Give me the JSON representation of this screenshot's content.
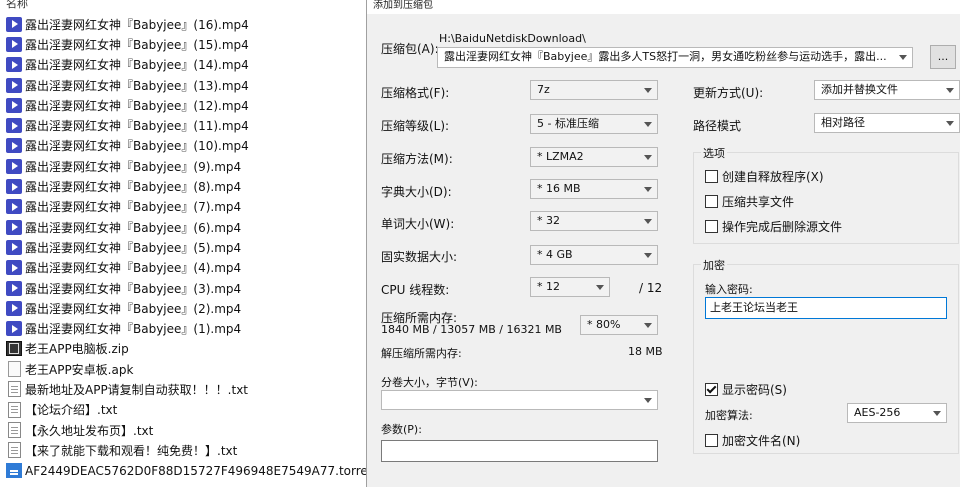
{
  "file_list": {
    "column_name": "名称",
    "files": [
      {
        "name": "露出淫妻网红女神『Babyjee』(16).mp4",
        "type": "video"
      },
      {
        "name": "露出淫妻网红女神『Babyjee』(15).mp4",
        "type": "video"
      },
      {
        "name": "露出淫妻网红女神『Babyjee』(14).mp4",
        "type": "video"
      },
      {
        "name": "露出淫妻网红女神『Babyjee』(13).mp4",
        "type": "video"
      },
      {
        "name": "露出淫妻网红女神『Babyjee』(12).mp4",
        "type": "video"
      },
      {
        "name": "露出淫妻网红女神『Babyjee』(11).mp4",
        "type": "video"
      },
      {
        "name": "露出淫妻网红女神『Babyjee』(10).mp4",
        "type": "video"
      },
      {
        "name": "露出淫妻网红女神『Babyjee』(9).mp4",
        "type": "video"
      },
      {
        "name": "露出淫妻网红女神『Babyjee』(8).mp4",
        "type": "video"
      },
      {
        "name": "露出淫妻网红女神『Babyjee』(7).mp4",
        "type": "video"
      },
      {
        "name": "露出淫妻网红女神『Babyjee』(6).mp4",
        "type": "video"
      },
      {
        "name": "露出淫妻网红女神『Babyjee』(5).mp4",
        "type": "video"
      },
      {
        "name": "露出淫妻网红女神『Babyjee』(4).mp4",
        "type": "video"
      },
      {
        "name": "露出淫妻网红女神『Babyjee』(3).mp4",
        "type": "video"
      },
      {
        "name": "露出淫妻网红女神『Babyjee』(2).mp4",
        "type": "video"
      },
      {
        "name": "露出淫妻网红女神『Babyjee』(1).mp4",
        "type": "video"
      },
      {
        "name": "老王APP电脑板.zip",
        "type": "zip"
      },
      {
        "name": "老王APP安卓板.apk",
        "type": "apk"
      },
      {
        "name": "最新地址及APP请复制自动获取！！！.txt",
        "type": "doc"
      },
      {
        "name": "【论坛介绍】.txt",
        "type": "doc"
      },
      {
        "name": "【永久地址发布页】.txt",
        "type": "doc"
      },
      {
        "name": "【来了就能下载和观看！纯免费！】.txt",
        "type": "doc"
      },
      {
        "name": "AF2449DEAC5762D0F88D15727F496948E7549A77.torrent",
        "type": "torrent"
      }
    ]
  },
  "dialog": {
    "title": "添加到压缩包",
    "archive_label": "压缩包(A):",
    "archive_path": "H:\\BaiduNetdiskDownload\\",
    "archive_name": "露出淫妻网红女神『Babyjee』露出多人TS怒打一洞，男女通吃粉丝参与运动选手，露出...",
    "browse_label": "...",
    "format_label": "压缩格式(F):",
    "format_value": "7z",
    "level_label": "压缩等级(L):",
    "level_value": "5 - 标准压缩",
    "method_label": "压缩方法(M):",
    "method_value": "* LZMA2",
    "dict_label": "字典大小(D):",
    "dict_value": "* 16 MB",
    "word_label": "单词大小(W):",
    "word_value": "* 32",
    "solid_label": "固实数据大小:",
    "solid_value": "* 4 GB",
    "cpu_label": "CPU 线程数:",
    "cpu_value": "* 12",
    "cpu_total": "/ 12",
    "mem_label": "压缩所需内存:",
    "mem_detail": "1840 MB / 13057 MB / 16321 MB",
    "mem_value": "* 80%",
    "decomp_label": "解压缩所需内存:",
    "decomp_value": "18 MB",
    "split_label": "分卷大小，字节(V):",
    "split_value": "",
    "params_label": "参数(P):",
    "params_value": "",
    "update_label": "更新方式(U):",
    "update_value": "添加并替换文件",
    "path_label": "路径模式",
    "path_value": "相对路径",
    "options_label": "选项",
    "opt_sfx": "创建自释放程序(X)",
    "opt_shared": "压缩共享文件",
    "opt_delete": "操作完成后删除源文件",
    "encryption_label": "加密",
    "password_label": "输入密码:",
    "password_value": "上老王论坛当老王",
    "show_password": "显示密码(S)",
    "enc_method_label": "加密算法:",
    "enc_method_value": "AES-256",
    "encrypt_names": "加密文件名(N)"
  }
}
